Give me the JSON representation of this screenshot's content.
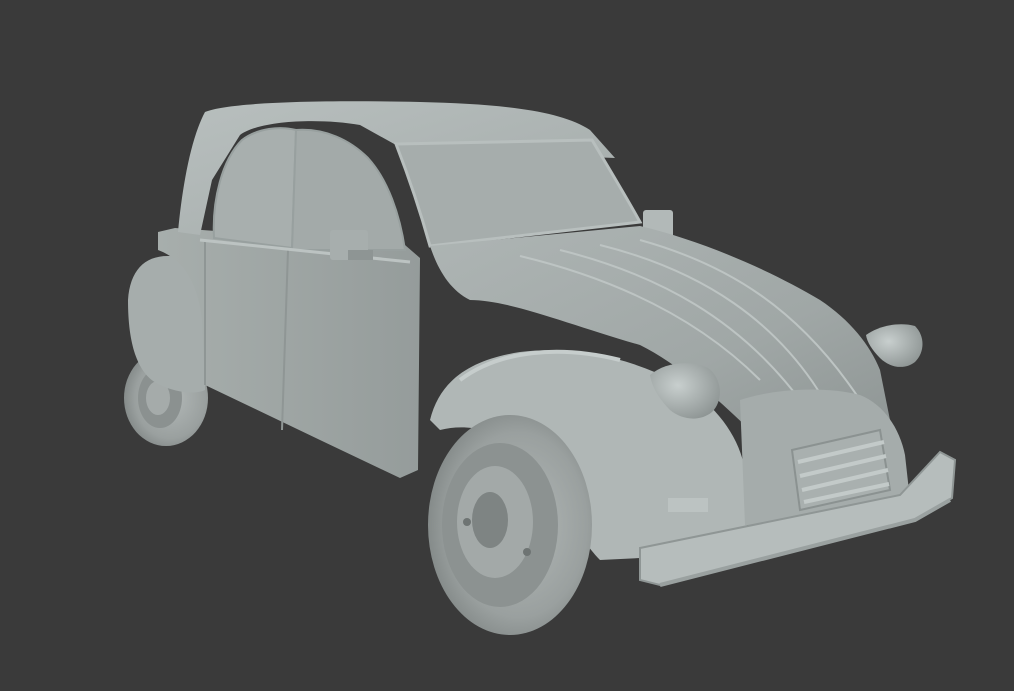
{
  "viewport": {
    "background": "#3a3a3a",
    "shading": "solid",
    "object": "car-model"
  },
  "colors": {
    "body_light": "#b9c0bf",
    "body_mid": "#a3aaa9",
    "body_dark": "#848b8a",
    "body_shadow": "#6c7271",
    "glass": "#a9b0af",
    "tire": "#9aa09f",
    "tire_dark": "#7b8180"
  }
}
